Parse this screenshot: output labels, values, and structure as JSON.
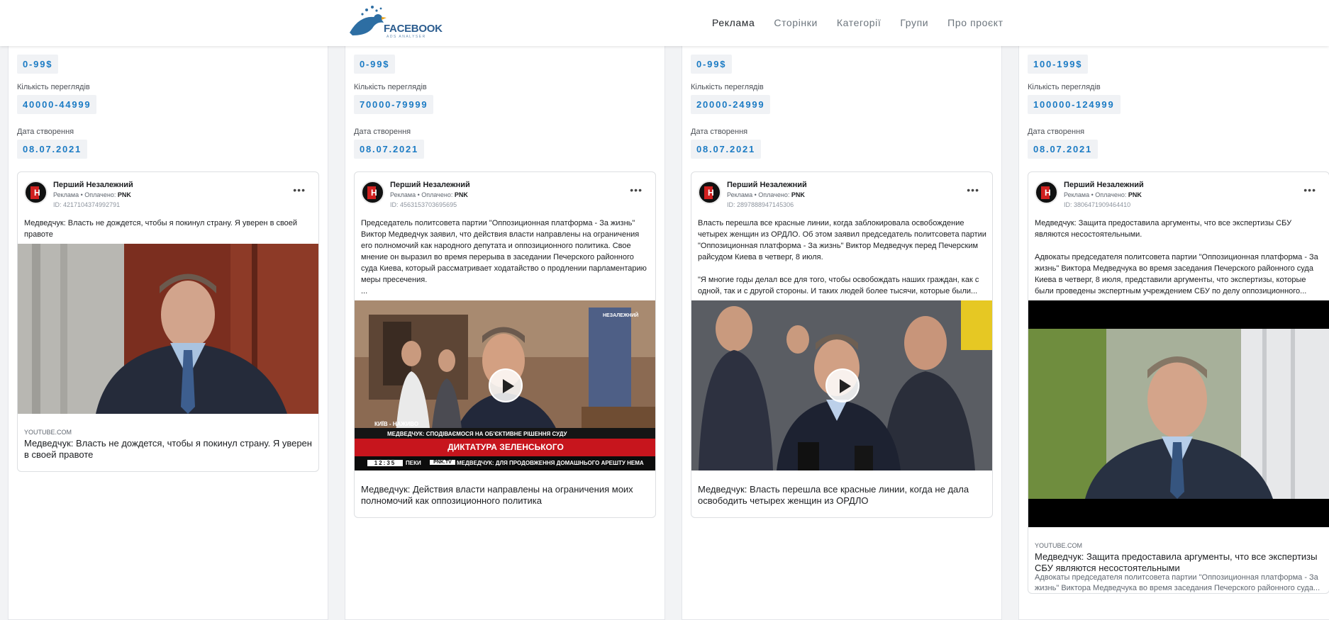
{
  "header": {
    "logo_text": "FACEBOOK",
    "logo_sub": "ADS ANALYSER",
    "nav": [
      "Реклама",
      "Сторінки",
      "Категорії",
      "Групи",
      "Про проєкт"
    ]
  },
  "labels": {
    "views": "Кількість переглядів",
    "created": "Дата створення"
  },
  "ads": [
    {
      "spend": "0-99$",
      "views": "40000-44999",
      "date": "08.07.2021",
      "page_name": "Перший Незалежний",
      "meta_prefix": "Реклама • Оплачено:",
      "meta_payer": "PNK",
      "id": "ID: 4217104374992791",
      "text": "Медведчук: Власть не дождется, чтобы я покинул страну. Я уверен в своей правоте",
      "domain": "YOUTUBE.COM",
      "link_title": "Медведчук: Власть не дождется, чтобы я покинул страну. Я уверен в своей правоте",
      "link_desc": ""
    },
    {
      "spend": "0-99$",
      "views": "70000-79999",
      "date": "08.07.2021",
      "page_name": "Перший Незалежний",
      "meta_prefix": "Реклама • Оплачено:",
      "meta_payer": "PNK",
      "id": "ID: 4563153703695695",
      "text": "Председатель политсовета партии \"Оппозиционная платформа - За жизнь\" Виктор Медведчук заявил, что действия власти направлены на ограничения его полномочий как народного депутата и оппозиционного политика. Свое мнение он выразил во время перерыва в заседании Печерского районного суда Киева, который рассматривает ходатайство о продлении парламентарию меры пресечения.\n...",
      "domain": "",
      "link_title": "Медведчук: Действия власти направлены на ограничения моих полномочий как оппозиционного политика",
      "link_desc": "",
      "tv": {
        "corner": "НЕЗАЛЕЖНИЙ",
        "city": "КИЇВ - НАЖИВО",
        "line1": "МЕДВЕДЧУК: СПОДІВАЄМОСЯ НА ОБ'ЄКТИВНЕ РІШЕННЯ СУДУ",
        "line2": "ДИКТАТУРА ЗЕЛЕНСЬКОГО",
        "time": "12:35",
        "tick_a": "ПЕКИ",
        "tick_b": "PNK.TV",
        "tick_c": "МЕДВЕДЧУК: ДЛЯ ПРОДОВЖЕННЯ ДОМАШНЬОГО АРЕШТУ НЕМА"
      }
    },
    {
      "spend": "0-99$",
      "views": "20000-24999",
      "date": "08.07.2021",
      "page_name": "Перший Незалежний",
      "meta_prefix": "Реклама • Оплачено:",
      "meta_payer": "PNK",
      "id": "ID: 2897888947145306",
      "text": "Власть перешла все красные линии, когда заблокировала освобождение четырех женщин из ОРДЛО. Об этом заявил председатель политсовета партии \"Оппозиционная платформа - За жизнь\" Виктор Медведчук перед Печерским райсудом Киева в четверг, 8 июля.\n\n\"Я многие годы делал все для того, чтобы освобождать наших граждан, как с одной, так и с другой стороны. И таких людей более тысячи, которые были...",
      "domain": "",
      "link_title": "Медведчук: Власть перешла все красные линии, когда не дала освободить четырех женщин из ОРДЛО",
      "link_desc": ""
    },
    {
      "spend": "100-199$",
      "views": "100000-124999",
      "date": "08.07.2021",
      "page_name": "Перший Незалежний",
      "meta_prefix": "Реклама • Оплачено:",
      "meta_payer": "PNK",
      "id": "ID: 3806471909464410",
      "text": "Медведчук: Защита предоставила аргументы, что все экспертизы СБУ являются несостоятельными.\n\nАдвокаты председателя политсовета партии \"Оппозиционная платформа - За жизнь\" Виктора Медведчука во время заседания Печерского районного суда Киева в четверг, 8 июля, представили аргументы, что экспертизы, которые были проведены экспертным учреждением СБУ по делу оппозиционного...",
      "domain": "YOUTUBE.COM",
      "link_title": "Медведчук: Защита предоставила аргументы, что все экспертизы СБУ являются несостоятельными",
      "link_desc": "Адвокаты председателя политсовета партии \"Оппозиционная платформа - За жизнь\" Виктора Медведчука во время заседания Печерского районного суда..."
    }
  ]
}
